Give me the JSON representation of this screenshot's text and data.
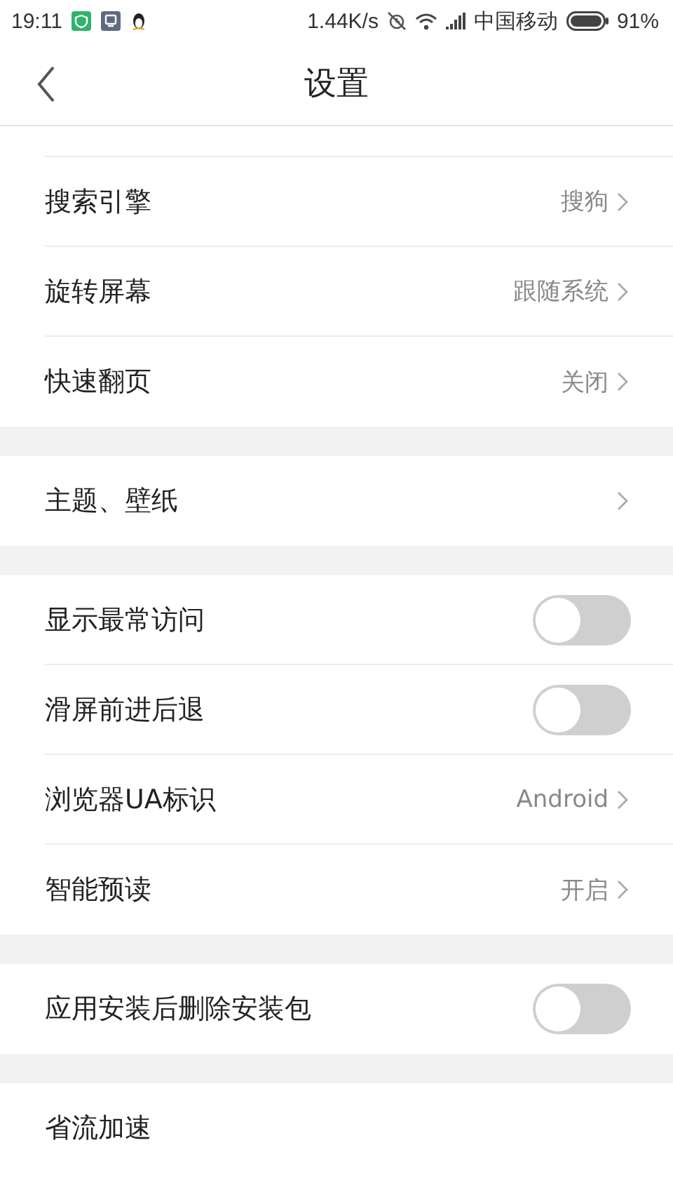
{
  "status_bar": {
    "time": "19:11",
    "speed": "1.44K/s",
    "carrier": "中国移动",
    "battery": "91%"
  },
  "header": {
    "title": "设置"
  },
  "sections": [
    {
      "rows": [
        {
          "kind": "value",
          "label": "搜索引擎",
          "value": "搜狗"
        },
        {
          "kind": "value",
          "label": "旋转屏幕",
          "value": "跟随系统"
        },
        {
          "kind": "value",
          "label": "快速翻页",
          "value": "关闭"
        }
      ]
    },
    {
      "rows": [
        {
          "kind": "link",
          "label": "主题、壁纸"
        }
      ]
    },
    {
      "rows": [
        {
          "kind": "toggle",
          "label": "显示最常访问",
          "on": false
        },
        {
          "kind": "toggle",
          "label": "滑屏前进后退",
          "on": false
        },
        {
          "kind": "value",
          "label": "浏览器UA标识",
          "value": "Android"
        },
        {
          "kind": "value",
          "label": "智能预读",
          "value": "开启"
        }
      ]
    },
    {
      "rows": [
        {
          "kind": "toggle",
          "label": "应用安装后删除安装包",
          "on": false
        }
      ]
    },
    {
      "rows": [
        {
          "kind": "plain",
          "label": "省流加速"
        }
      ]
    }
  ]
}
